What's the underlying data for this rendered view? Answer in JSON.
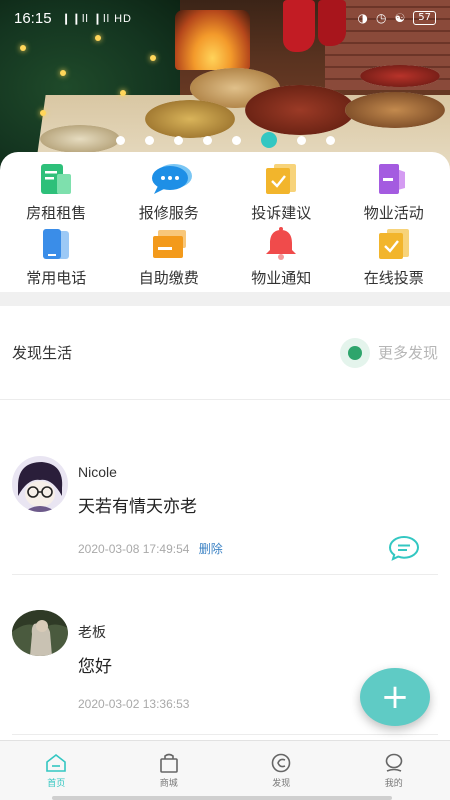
{
  "status_bar": {
    "time": "16:15",
    "signal": "❙❙ll ❙ll HD",
    "battery": "57"
  },
  "banner": {
    "slide_count": 8,
    "active_slide": 5,
    "accent_color": "#33c7c2"
  },
  "services": [
    {
      "label": "房租租售",
      "icon": "house-doc-icon",
      "color": "#2ec07a"
    },
    {
      "label": "报修服务",
      "icon": "chat-bubble-icon",
      "color": "#1e8fe6"
    },
    {
      "label": "投诉建议",
      "icon": "check-folder-icon",
      "color": "#f2b52c"
    },
    {
      "label": "物业活动",
      "icon": "flag-icon",
      "color": "#a45be0"
    },
    {
      "label": "常用电话",
      "icon": "phone-icon",
      "color": "#3a8de8"
    },
    {
      "label": "自助缴费",
      "icon": "wallet-icon",
      "color": "#f39a1b"
    },
    {
      "label": "物业通知",
      "icon": "bell-icon",
      "color": "#f04b4b"
    },
    {
      "label": "在线投票",
      "icon": "vote-folder-icon",
      "color": "#f2b52c"
    }
  ],
  "discover": {
    "title": "发现生活",
    "more_label": "更多发现"
  },
  "posts": [
    {
      "author": "Nicole",
      "content": "天若有情天亦老",
      "time": "2020-03-08 17:49:54",
      "delete_label": "删除"
    },
    {
      "author": "老板",
      "content": "您好",
      "time": "2020-03-02 13:36:53"
    }
  ],
  "fab": {
    "label": "+"
  },
  "tabs": [
    {
      "label": "首页",
      "icon": "home-icon",
      "active": true
    },
    {
      "label": "商城",
      "icon": "shopping-bag-icon",
      "active": false
    },
    {
      "label": "发现",
      "icon": "compass-icon",
      "active": false
    },
    {
      "label": "我的",
      "icon": "user-icon",
      "active": false
    }
  ]
}
